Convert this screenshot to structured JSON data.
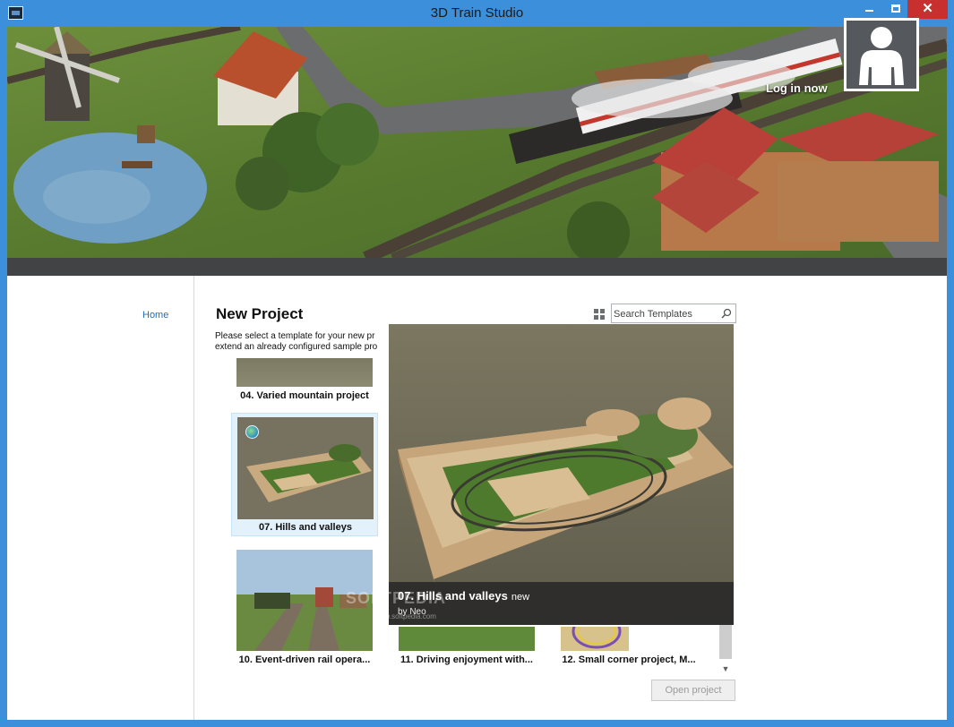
{
  "window": {
    "title": "3D Train Studio",
    "close_glyph": "✕"
  },
  "banner": {
    "login_label": "Log in now"
  },
  "nav": {
    "home_label": "Home"
  },
  "main": {
    "heading": "New Project",
    "description_line1": "Please select a template for your new pr",
    "description_line2": "extend an already configured sample pro",
    "search_placeholder": "Search Templates",
    "open_button_label": "Open project",
    "templates": [
      {
        "label": "04. Varied mountain project"
      },
      {
        "label": "07. Hills and valleys"
      },
      {
        "label": "10. Event-driven rail opera..."
      },
      {
        "label": "11. Driving enjoyment with..."
      },
      {
        "label": "12. Small corner project, M..."
      }
    ]
  },
  "preview": {
    "title": "07. Hills and valleys",
    "badge": "new",
    "author": "by Neo"
  },
  "watermark": {
    "text": "SOFTPEDIA",
    "url": "www.softpedia.com"
  },
  "colors": {
    "window_frame": "#3b8fdb",
    "close_button": "#c7302f",
    "link": "#1f6fb8",
    "selected_card": "#e3f1fb"
  }
}
